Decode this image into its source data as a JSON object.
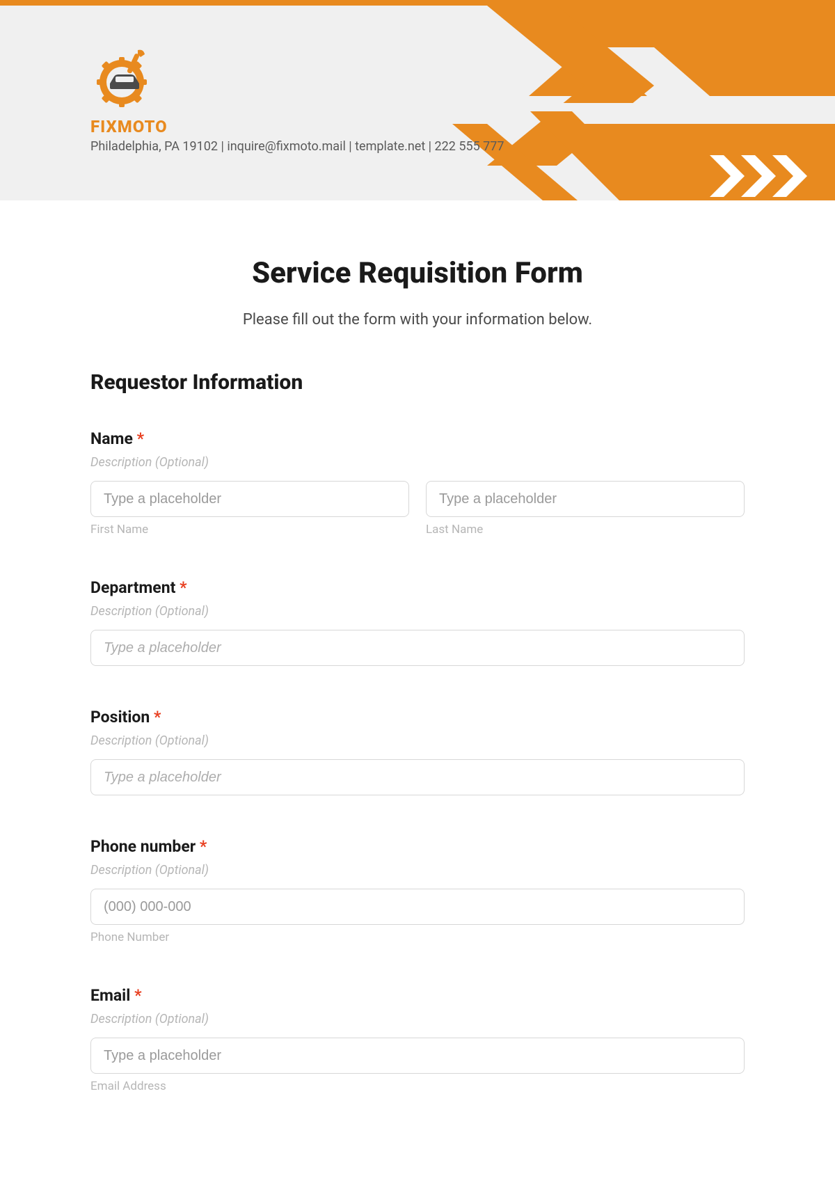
{
  "header": {
    "brand_name": "FIXMOTO",
    "brand_info": "Philadelphia, PA 19102 | inquire@fixmoto.mail | template.net | 222 555 777"
  },
  "form": {
    "title": "Service Requisition Form",
    "subtitle": "Please fill out the form with your information below.",
    "section_heading": "Requestor Information",
    "name": {
      "label": "Name",
      "required": "*",
      "desc": "Description (Optional)",
      "first_placeholder": "Type a placeholder",
      "first_sub": "First Name",
      "last_placeholder": "Type a placeholder",
      "last_sub": "Last Name"
    },
    "department": {
      "label": "Department",
      "required": "*",
      "desc": "Description (Optional)",
      "placeholder": "Type a placeholder"
    },
    "position": {
      "label": "Position",
      "required": "*",
      "desc": "Description (Optional)",
      "placeholder": "Type a placeholder"
    },
    "phone": {
      "label": "Phone number",
      "required": "*",
      "desc": "Description (Optional)",
      "placeholder": "(000) 000-000",
      "sub": "Phone Number"
    },
    "email": {
      "label": "Email",
      "required": "*",
      "desc": "Description (Optional)",
      "placeholder": "Type a placeholder",
      "sub": "Email Address"
    }
  }
}
